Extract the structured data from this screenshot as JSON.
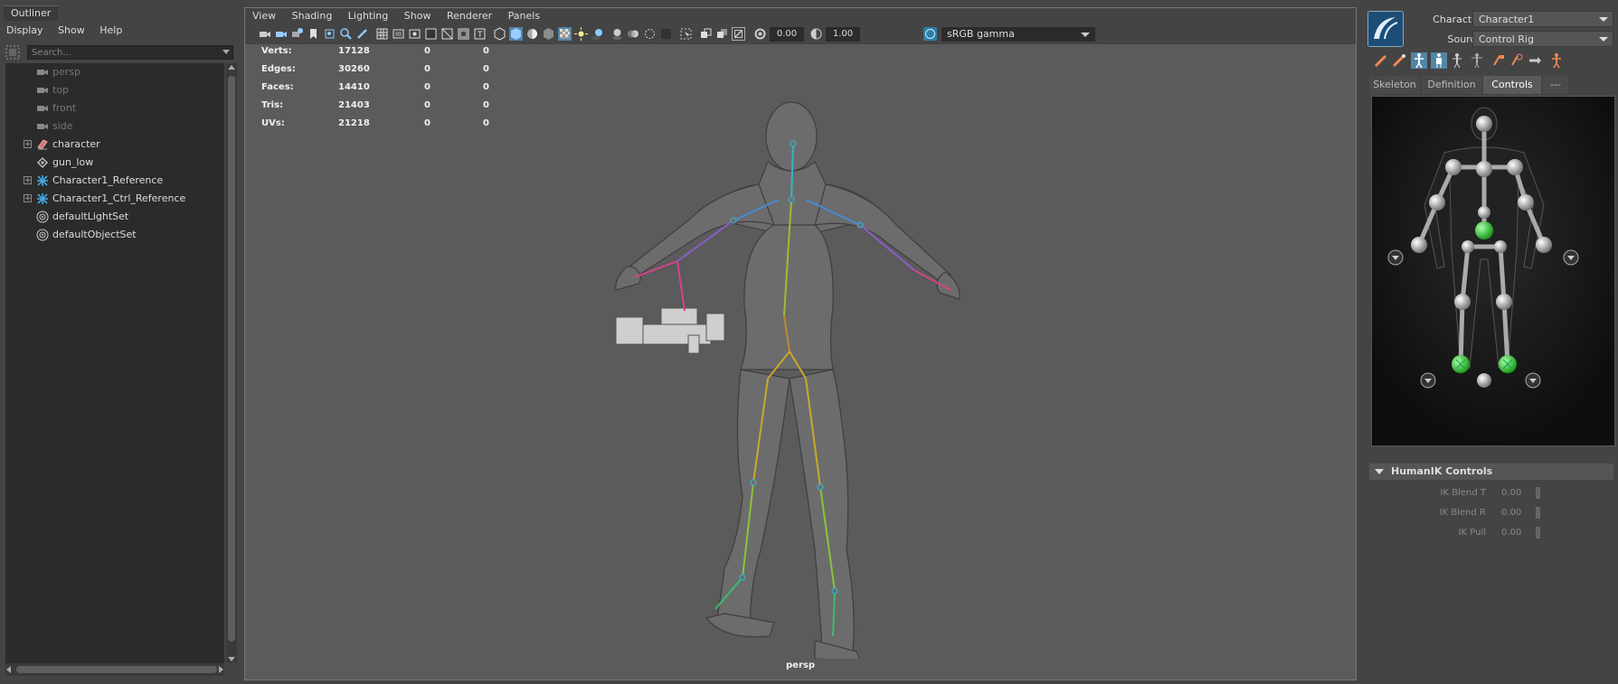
{
  "outliner": {
    "title": "Outliner",
    "menu": [
      "Display",
      "Show",
      "Help"
    ],
    "search_placeholder": "Search...",
    "items": [
      {
        "label": "persp",
        "icon": "camera-icon",
        "dim": true,
        "expandable": false
      },
      {
        "label": "top",
        "icon": "camera-icon",
        "dim": true,
        "expandable": false
      },
      {
        "label": "front",
        "icon": "camera-icon",
        "dim": true,
        "expandable": false
      },
      {
        "label": "side",
        "icon": "camera-icon",
        "dim": true,
        "expandable": false
      },
      {
        "label": "character",
        "icon": "mesh-group-icon",
        "dim": false,
        "expandable": true
      },
      {
        "label": "gun_low",
        "icon": "mesh-icon",
        "dim": false,
        "expandable": false
      },
      {
        "label": "Character1_Reference",
        "icon": "joint-icon",
        "dim": false,
        "expandable": true
      },
      {
        "label": "Character1_Ctrl_Reference",
        "icon": "joint-icon",
        "dim": false,
        "expandable": true
      },
      {
        "label": "defaultLightSet",
        "icon": "set-icon",
        "dim": false,
        "expandable": false
      },
      {
        "label": "defaultObjectSet",
        "icon": "set-icon",
        "dim": false,
        "expandable": false
      }
    ]
  },
  "viewport": {
    "menu": [
      "View",
      "Shading",
      "Lighting",
      "Show",
      "Renderer",
      "Panels"
    ],
    "exposure": "0.00",
    "gamma": "1.00",
    "color_space": "sRGB gamma",
    "camera": "persp",
    "stats": [
      {
        "label": "Verts:",
        "a": "17128",
        "b": "0",
        "c": "0"
      },
      {
        "label": "Edges:",
        "a": "30260",
        "b": "0",
        "c": "0"
      },
      {
        "label": "Faces:",
        "a": "14410",
        "b": "0",
        "c": "0"
      },
      {
        "label": "Tris:",
        "a": "21403",
        "b": "0",
        "c": "0"
      },
      {
        "label": "UVs:",
        "a": "21218",
        "b": "0",
        "c": "0"
      }
    ]
  },
  "humanik": {
    "character_label": "Character:",
    "character_value": "Character1",
    "source_label": "Source:",
    "source_value": "Control Rig",
    "tabs": [
      "Skeleton",
      "Definition",
      "Controls",
      "---"
    ],
    "active_tab": "Controls",
    "controls_header": "HumanIK Controls",
    "sliders": [
      {
        "label": "IK Blend T",
        "value": "0.00"
      },
      {
        "label": "IK Blend R",
        "value": "0.00"
      },
      {
        "label": "IK Pull",
        "value": "0.00"
      }
    ],
    "colors": {
      "effector_active": "#33cc33",
      "effector": "#cccccc"
    }
  }
}
